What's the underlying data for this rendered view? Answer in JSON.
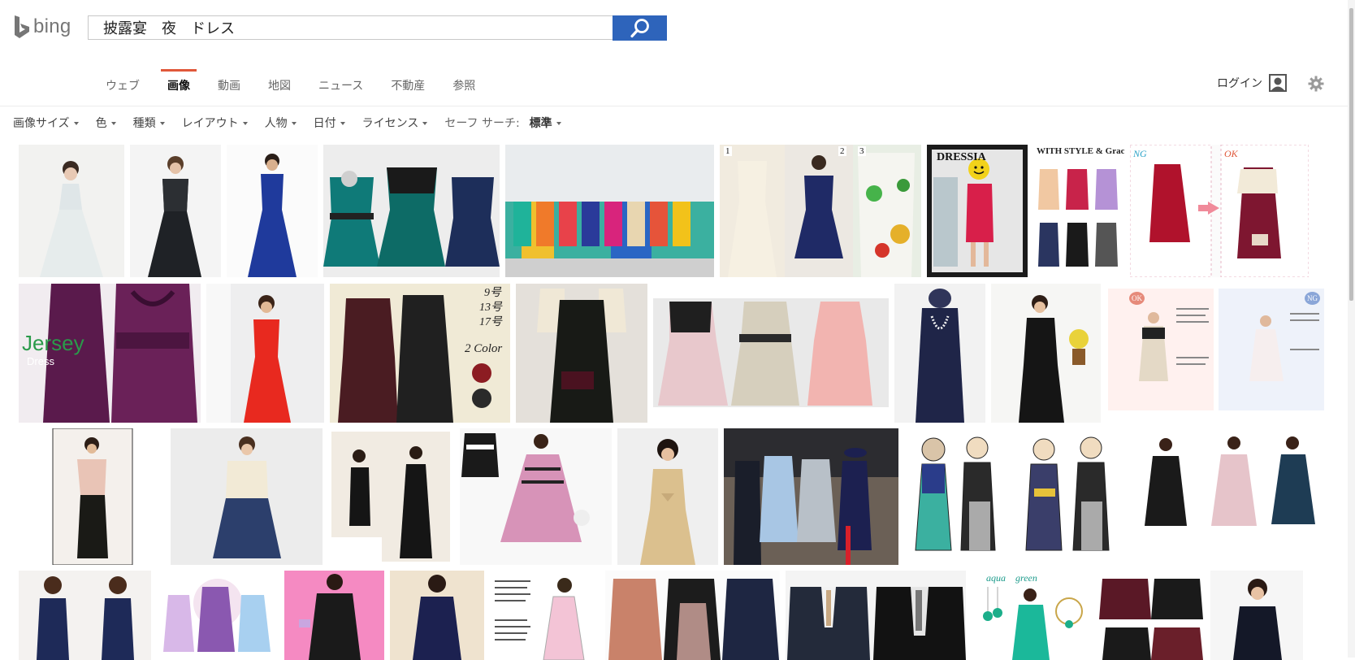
{
  "header": {
    "logo_text": "bing",
    "search_value": "披露宴　夜　ドレス",
    "search_button_icon": "magnifier-icon",
    "accent_color": "#2e64bb"
  },
  "nav": {
    "tabs": [
      {
        "label": "ウェブ",
        "active": false
      },
      {
        "label": "画像",
        "active": true
      },
      {
        "label": "動画",
        "active": false
      },
      {
        "label": "地図",
        "active": false
      },
      {
        "label": "ニュース",
        "active": false
      },
      {
        "label": "不動産",
        "active": false
      },
      {
        "label": "参照",
        "active": false
      }
    ],
    "active_color": "#e0583a",
    "login_label": "ログイン"
  },
  "filters": {
    "items": [
      "画像サイズ",
      "色",
      "種類",
      "レイアウト",
      "人物",
      "日付",
      "ライセンス"
    ],
    "safe_label": "セーフ サーチ:",
    "safe_value": "標準"
  },
  "results": {
    "overlay_texts": {
      "t1_5_num1": "1",
      "t1_5_num2": "2",
      "t1_5_num3": "3",
      "t1_6": "DRESSIA",
      "t1_7": "WITH STYLE & Grace",
      "t1_8_ng": "NG",
      "t1_8_ok": "OK",
      "t2_1": "Jersey",
      "t2_1b": "Dress",
      "t2_3_a": "9号",
      "t2_3_b": "13号",
      "t2_3_c": "17号",
      "t2_3_d": "2 Color",
      "t2_8_ok": "OK",
      "t2_8_ng": "NG",
      "t4_7": "aqua　green"
    }
  }
}
